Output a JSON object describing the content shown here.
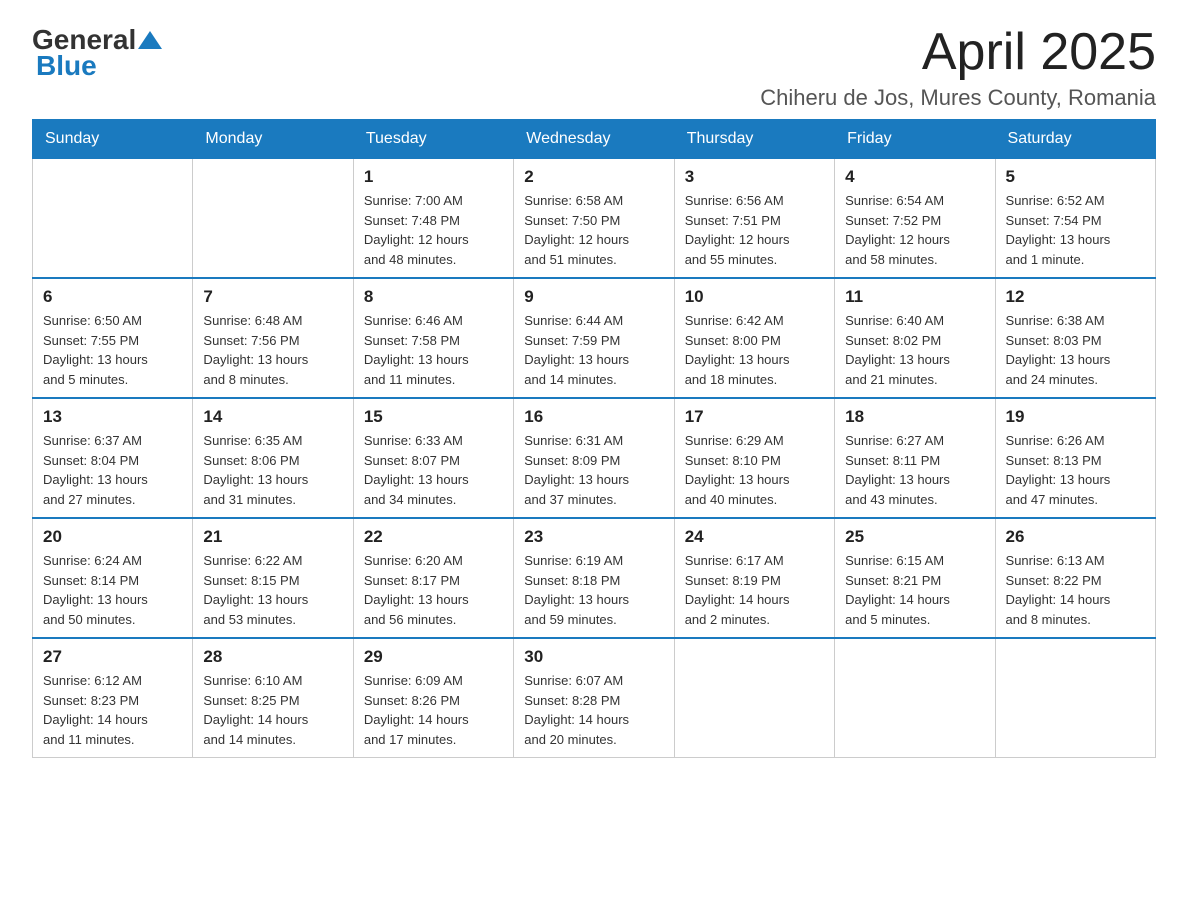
{
  "header": {
    "logo_general": "General",
    "logo_blue": "Blue",
    "month_title": "April 2025",
    "location": "Chiheru de Jos, Mures County, Romania"
  },
  "weekdays": [
    "Sunday",
    "Monday",
    "Tuesday",
    "Wednesday",
    "Thursday",
    "Friday",
    "Saturday"
  ],
  "weeks": [
    [
      {
        "day": "",
        "info": ""
      },
      {
        "day": "",
        "info": ""
      },
      {
        "day": "1",
        "info": "Sunrise: 7:00 AM\nSunset: 7:48 PM\nDaylight: 12 hours\nand 48 minutes."
      },
      {
        "day": "2",
        "info": "Sunrise: 6:58 AM\nSunset: 7:50 PM\nDaylight: 12 hours\nand 51 minutes."
      },
      {
        "day": "3",
        "info": "Sunrise: 6:56 AM\nSunset: 7:51 PM\nDaylight: 12 hours\nand 55 minutes."
      },
      {
        "day": "4",
        "info": "Sunrise: 6:54 AM\nSunset: 7:52 PM\nDaylight: 12 hours\nand 58 minutes."
      },
      {
        "day": "5",
        "info": "Sunrise: 6:52 AM\nSunset: 7:54 PM\nDaylight: 13 hours\nand 1 minute."
      }
    ],
    [
      {
        "day": "6",
        "info": "Sunrise: 6:50 AM\nSunset: 7:55 PM\nDaylight: 13 hours\nand 5 minutes."
      },
      {
        "day": "7",
        "info": "Sunrise: 6:48 AM\nSunset: 7:56 PM\nDaylight: 13 hours\nand 8 minutes."
      },
      {
        "day": "8",
        "info": "Sunrise: 6:46 AM\nSunset: 7:58 PM\nDaylight: 13 hours\nand 11 minutes."
      },
      {
        "day": "9",
        "info": "Sunrise: 6:44 AM\nSunset: 7:59 PM\nDaylight: 13 hours\nand 14 minutes."
      },
      {
        "day": "10",
        "info": "Sunrise: 6:42 AM\nSunset: 8:00 PM\nDaylight: 13 hours\nand 18 minutes."
      },
      {
        "day": "11",
        "info": "Sunrise: 6:40 AM\nSunset: 8:02 PM\nDaylight: 13 hours\nand 21 minutes."
      },
      {
        "day": "12",
        "info": "Sunrise: 6:38 AM\nSunset: 8:03 PM\nDaylight: 13 hours\nand 24 minutes."
      }
    ],
    [
      {
        "day": "13",
        "info": "Sunrise: 6:37 AM\nSunset: 8:04 PM\nDaylight: 13 hours\nand 27 minutes."
      },
      {
        "day": "14",
        "info": "Sunrise: 6:35 AM\nSunset: 8:06 PM\nDaylight: 13 hours\nand 31 minutes."
      },
      {
        "day": "15",
        "info": "Sunrise: 6:33 AM\nSunset: 8:07 PM\nDaylight: 13 hours\nand 34 minutes."
      },
      {
        "day": "16",
        "info": "Sunrise: 6:31 AM\nSunset: 8:09 PM\nDaylight: 13 hours\nand 37 minutes."
      },
      {
        "day": "17",
        "info": "Sunrise: 6:29 AM\nSunset: 8:10 PM\nDaylight: 13 hours\nand 40 minutes."
      },
      {
        "day": "18",
        "info": "Sunrise: 6:27 AM\nSunset: 8:11 PM\nDaylight: 13 hours\nand 43 minutes."
      },
      {
        "day": "19",
        "info": "Sunrise: 6:26 AM\nSunset: 8:13 PM\nDaylight: 13 hours\nand 47 minutes."
      }
    ],
    [
      {
        "day": "20",
        "info": "Sunrise: 6:24 AM\nSunset: 8:14 PM\nDaylight: 13 hours\nand 50 minutes."
      },
      {
        "day": "21",
        "info": "Sunrise: 6:22 AM\nSunset: 8:15 PM\nDaylight: 13 hours\nand 53 minutes."
      },
      {
        "day": "22",
        "info": "Sunrise: 6:20 AM\nSunset: 8:17 PM\nDaylight: 13 hours\nand 56 minutes."
      },
      {
        "day": "23",
        "info": "Sunrise: 6:19 AM\nSunset: 8:18 PM\nDaylight: 13 hours\nand 59 minutes."
      },
      {
        "day": "24",
        "info": "Sunrise: 6:17 AM\nSunset: 8:19 PM\nDaylight: 14 hours\nand 2 minutes."
      },
      {
        "day": "25",
        "info": "Sunrise: 6:15 AM\nSunset: 8:21 PM\nDaylight: 14 hours\nand 5 minutes."
      },
      {
        "day": "26",
        "info": "Sunrise: 6:13 AM\nSunset: 8:22 PM\nDaylight: 14 hours\nand 8 minutes."
      }
    ],
    [
      {
        "day": "27",
        "info": "Sunrise: 6:12 AM\nSunset: 8:23 PM\nDaylight: 14 hours\nand 11 minutes."
      },
      {
        "day": "28",
        "info": "Sunrise: 6:10 AM\nSunset: 8:25 PM\nDaylight: 14 hours\nand 14 minutes."
      },
      {
        "day": "29",
        "info": "Sunrise: 6:09 AM\nSunset: 8:26 PM\nDaylight: 14 hours\nand 17 minutes."
      },
      {
        "day": "30",
        "info": "Sunrise: 6:07 AM\nSunset: 8:28 PM\nDaylight: 14 hours\nand 20 minutes."
      },
      {
        "day": "",
        "info": ""
      },
      {
        "day": "",
        "info": ""
      },
      {
        "day": "",
        "info": ""
      }
    ]
  ]
}
